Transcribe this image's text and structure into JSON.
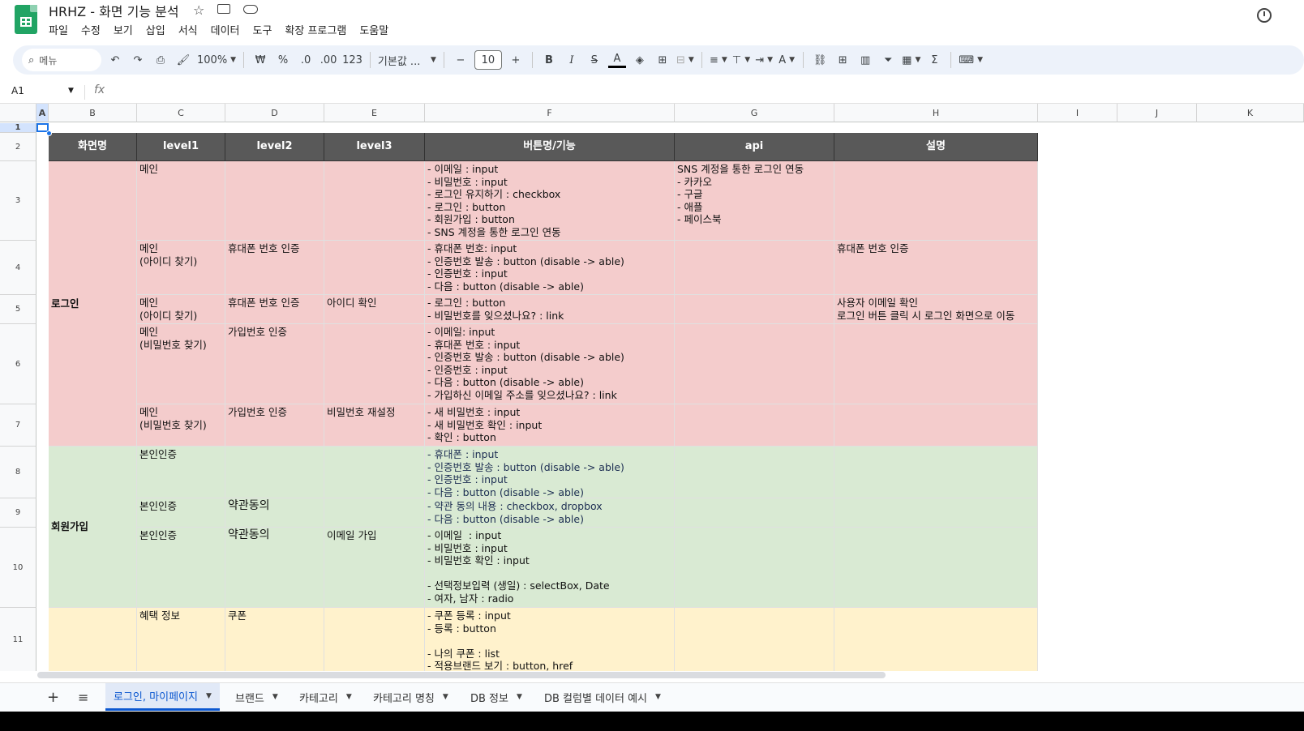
{
  "doc": {
    "title": "HRHZ - 화면 기능 분석"
  },
  "menu": [
    "파일",
    "수정",
    "보기",
    "삽입",
    "서식",
    "데이터",
    "도구",
    "확장 프로그램",
    "도움말"
  ],
  "toolbar": {
    "search_placeholder": "메뉴",
    "zoom": "100%",
    "currency": "₩",
    "percent": "%",
    "dec_decrease": ".0",
    "dec_increase": ".00",
    "number_format": "123",
    "font": "기본값 ...",
    "font_size": "10"
  },
  "formula_bar": {
    "cell_ref": "A1",
    "fx": "fx",
    "value": ""
  },
  "columns": [
    "A",
    "B",
    "C",
    "D",
    "E",
    "F",
    "G",
    "H",
    "I",
    "J",
    "K"
  ],
  "rows": [
    "1",
    "2",
    "3",
    "4",
    "5",
    "6",
    "7",
    "8",
    "9",
    "10",
    "11"
  ],
  "table": {
    "headers": [
      "화면명",
      "level1",
      "level2",
      "level3",
      "버튼명/기능",
      "api",
      "설명"
    ],
    "groups": [
      "로그인",
      "회원가입"
    ],
    "rows": [
      {
        "c": "메인",
        "d": "",
        "e": "",
        "f": "- 이메일 : input\n- 비밀번호 : input\n- 로그인 유지하기 : checkbox\n- 로그인 : button\n- 회원가입 : button\n- SNS 계정을 통한 로그인 연동",
        "g": "SNS 계정을 통한 로그인 연동\n- 카카오\n- 구글\n- 애플\n- 페이스북",
        "h": ""
      },
      {
        "c": "메인\n(아이디 찾기)",
        "d": "휴대폰 번호 인증",
        "e": "",
        "f": "- 휴대폰 번호: input\n- 인증번호 발송 : button (disable -> able)\n- 인증번호 : input\n- 다음 : button (disable -> able)",
        "g": "",
        "h": "휴대폰 번호 인증"
      },
      {
        "c": "메인\n(아이디 찾기)",
        "d": "휴대폰 번호 인증",
        "e": "아이디 확인",
        "f": "- 로그인 : button\n- 비밀번호를 잊으셨나요? : link",
        "g": "",
        "h": "사용자 이메일 확인\n로그인 버튼 클릭 시 로그인 화면으로 이동"
      },
      {
        "c": "메인\n(비밀번호 찾기)",
        "d": "가입번호 인증",
        "e": "",
        "f": "- 이메일: input\n- 휴대폰 번호 : input\n- 인증번호 발송 : button (disable -> able)\n- 인증번호 : input\n- 다음 : button (disable -> able)\n- 가입하신 이메일 주소를 잊으셨나요? : link",
        "g": "",
        "h": ""
      },
      {
        "c": "메인\n(비밀번호 찾기)",
        "d": "가입번호 인증",
        "e": "비밀번호 재설정",
        "f": "- 새 비밀번호 : input\n- 새 비밀번호 확인 : input\n- 확인 : button",
        "g": "",
        "h": ""
      },
      {
        "c": "본인인증",
        "d": "",
        "e": "",
        "f": "- 휴대폰 : input\n- 인증번호 발송 : button (disable -> able)\n- 인증번호 : input\n- 다음 : button (disable -> able)",
        "g": "",
        "h": ""
      },
      {
        "c": "본인인증",
        "d": "약관동의",
        "e": "",
        "f": "- 약관 동의 내용 : checkbox, dropbox\n- 다음 : button (disable -> able)",
        "g": "",
        "h": ""
      },
      {
        "c": "본인인증",
        "d": "약관동의",
        "e": "이메일 가입",
        "f": "- 이메일  : input\n- 비밀번호 : input\n- 비밀번호 확인 : input\n\n- 선택정보입력 (생일) : selectBox, Date\n- 여자, 남자 : radio",
        "g": "",
        "h": ""
      },
      {
        "c": "혜택 정보",
        "d": "쿠폰",
        "e": "",
        "f": "- 쿠폰 등록 : input\n- 등록 : button\n\n- 나의 쿠폰 : list\n- 적용브랜드 보기 : button, href",
        "g": "",
        "h": ""
      }
    ]
  },
  "tabs": [
    "로그인, 마이페이지",
    "브랜드",
    "카테고리",
    "카테고리 명칭",
    "DB 정보",
    "DB 컬럼별 데이터 예시"
  ]
}
